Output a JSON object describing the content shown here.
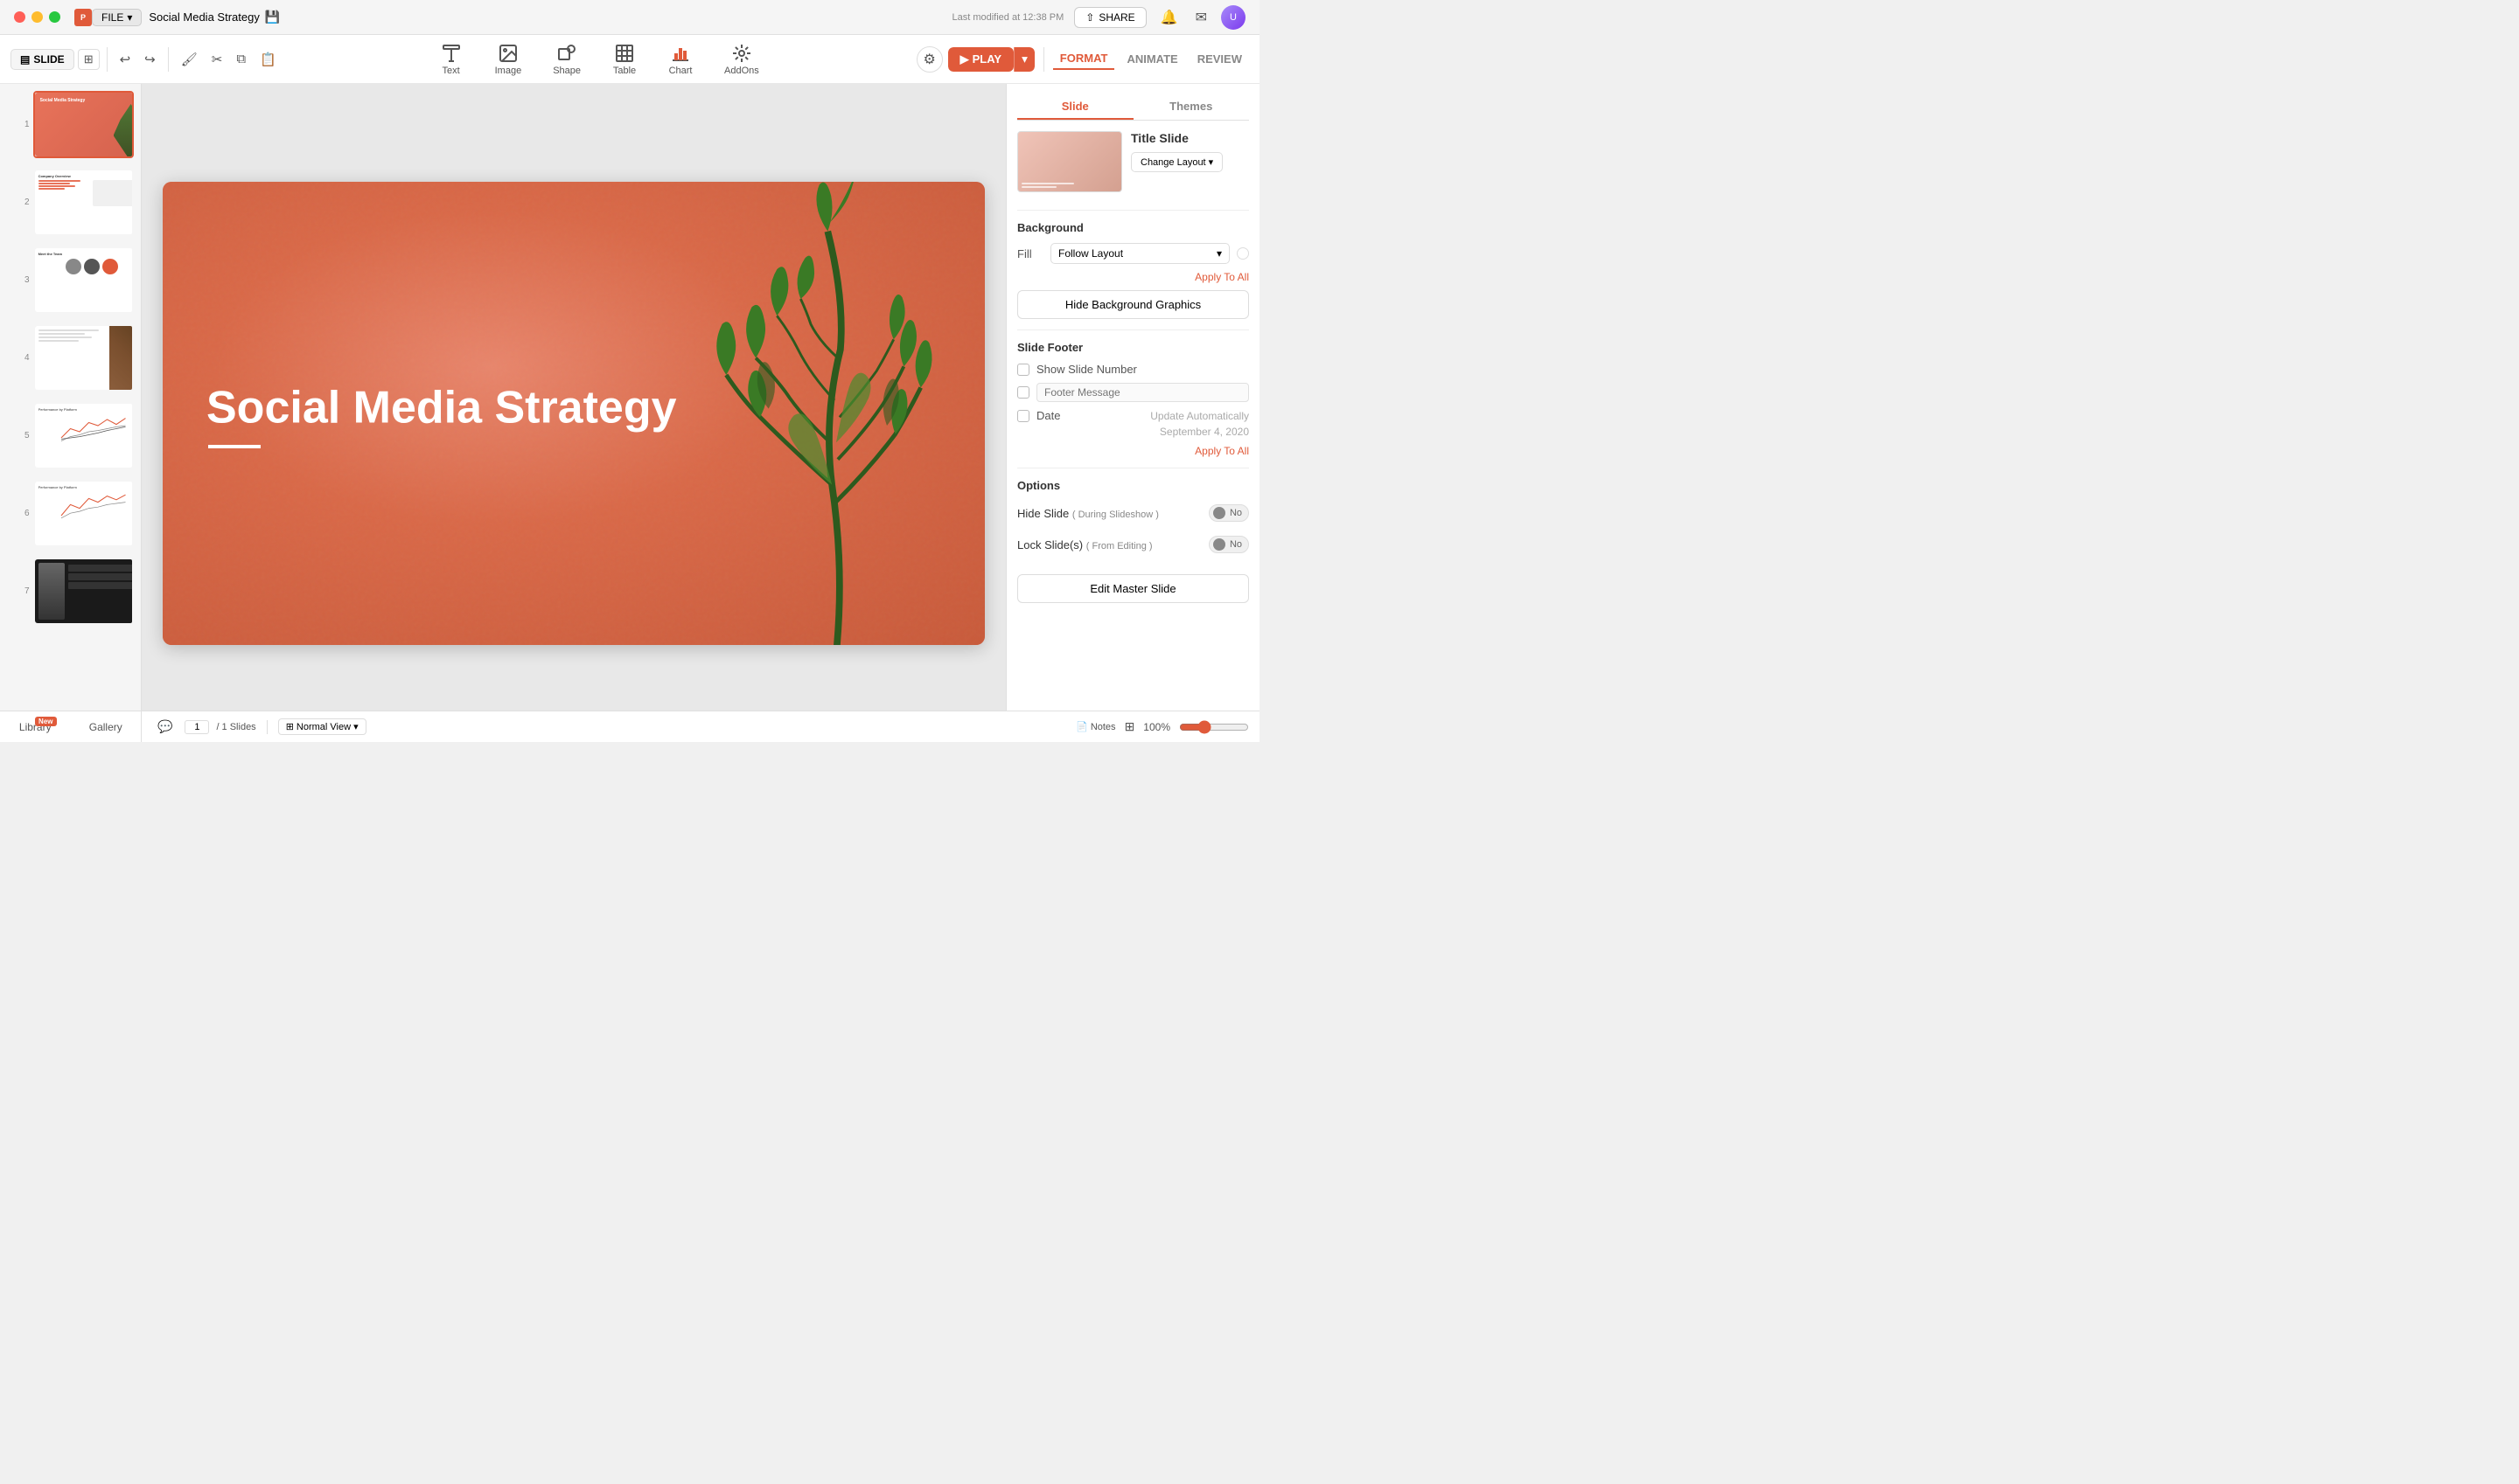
{
  "titlebar": {
    "file_label": "FILE",
    "presentation_title": "Social Media Strategy",
    "last_modified": "Last modified at 12:38 PM",
    "share_label": "SHARE"
  },
  "toolbar": {
    "slide_label": "SLIDE",
    "tools": [
      {
        "id": "text",
        "label": "Text",
        "icon": "T"
      },
      {
        "id": "image",
        "label": "Image",
        "icon": "🖼"
      },
      {
        "id": "shape",
        "label": "Shape",
        "icon": "◻"
      },
      {
        "id": "table",
        "label": "Table",
        "icon": "⊞"
      },
      {
        "id": "chart",
        "label": "Chart",
        "icon": "📊"
      },
      {
        "id": "addons",
        "label": "AddOns",
        "icon": "⊕"
      }
    ],
    "play_label": "PLAY",
    "format_label": "FORMAT",
    "animate_label": "ANIMATE",
    "review_label": "REVIEW"
  },
  "slide_panel": {
    "slides": [
      {
        "num": 1,
        "type": "title"
      },
      {
        "num": 2,
        "type": "overview"
      },
      {
        "num": 3,
        "type": "team"
      },
      {
        "num": 4,
        "type": "content"
      },
      {
        "num": 5,
        "type": "chart1"
      },
      {
        "num": 6,
        "type": "chart2"
      },
      {
        "num": 7,
        "type": "dark"
      }
    ]
  },
  "canvas": {
    "slide_title": "Social Media Strategy"
  },
  "right_panel": {
    "tabs": [
      {
        "id": "slide",
        "label": "Slide"
      },
      {
        "id": "themes",
        "label": "Themes"
      }
    ],
    "layout": {
      "name": "Title Slide",
      "change_label": "Change Layout"
    },
    "background": {
      "section_title": "Background",
      "fill_label": "Fill",
      "fill_value": "Follow Layout",
      "apply_all": "Apply To All",
      "hide_bg_btn": "Hide Background Graphics"
    },
    "footer": {
      "section_title": "Slide Footer",
      "show_slide_num_label": "Show Slide Number",
      "footer_msg_label": "Footer Message",
      "footer_placeholder": "Footer Message",
      "date_label": "Date",
      "update_auto_label": "Update Automatically",
      "date_value": "September 4, 2020",
      "apply_all": "Apply To All"
    },
    "options": {
      "section_title": "Options",
      "hide_slide_label": "Hide Slide",
      "hide_slide_sub": "( During Slideshow )",
      "hide_slide_val": "No",
      "lock_slides_label": "Lock Slide(s)",
      "lock_slides_sub": "( From Editing )",
      "lock_slides_val": "No"
    },
    "edit_master_label": "Edit Master Slide"
  },
  "bottom": {
    "page_current": "1",
    "page_total": "/ 1 Slides",
    "view_label": "Normal View",
    "notes_label": "Notes",
    "zoom_pct": "100%"
  },
  "library": {
    "library_label": "Library",
    "gallery_label": "Gallery",
    "new_badge": "New"
  }
}
